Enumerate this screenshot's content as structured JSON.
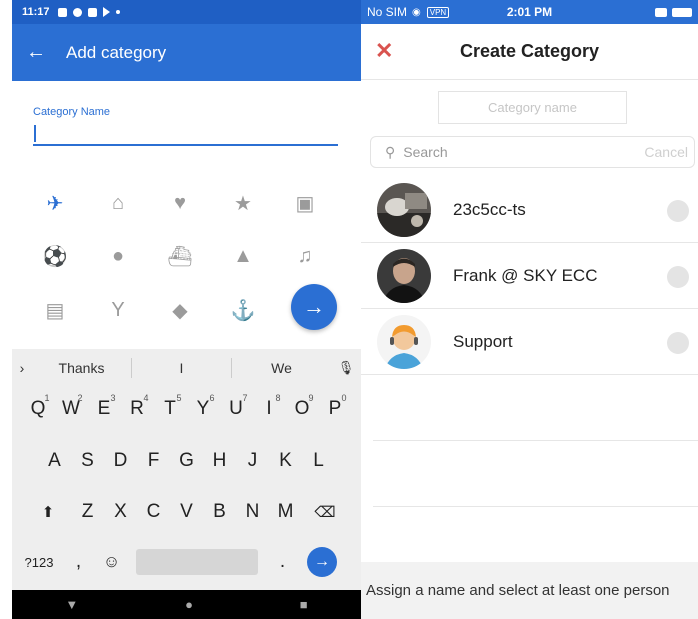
{
  "android": {
    "status": {
      "time": "11:17"
    },
    "appbar": {
      "title": "Add category"
    },
    "form": {
      "label": "Category Name",
      "value": ""
    },
    "icons": [
      "airplane-icon",
      "home-icon",
      "heart-icon",
      "star-icon",
      "briefcase-icon",
      "soccer-icon",
      "baseball-icon",
      "ship-icon",
      "mountain-icon",
      "music-icon",
      "beer-icon",
      "cocktail-icon",
      "diamond-icon",
      "anchor-icon"
    ],
    "keyboard": {
      "suggestions": [
        "Thanks",
        "I",
        "We"
      ],
      "row1": [
        "Q",
        "W",
        "E",
        "R",
        "T",
        "Y",
        "U",
        "I",
        "O",
        "P"
      ],
      "row1_nums": [
        "1",
        "2",
        "3",
        "4",
        "5",
        "6",
        "7",
        "8",
        "9",
        "0"
      ],
      "row2": [
        "A",
        "S",
        "D",
        "F",
        "G",
        "H",
        "J",
        "K",
        "L"
      ],
      "row3": [
        "Z",
        "X",
        "C",
        "V",
        "B",
        "N",
        "M"
      ],
      "sym": "?123",
      "comma": ",",
      "period": "."
    }
  },
  "ios": {
    "status": {
      "carrier": "No SIM",
      "vpn": "VPN",
      "time": "2:01 PM"
    },
    "nav": {
      "title": "Create Category"
    },
    "category_placeholder": "Category name",
    "search": {
      "placeholder": "Search",
      "cancel": "Cancel"
    },
    "contacts": [
      {
        "name": "23c5cc-ts"
      },
      {
        "name": "Frank @ SKY ECC"
      },
      {
        "name": "Support"
      }
    ],
    "footer": "Assign a name and select at least one person"
  }
}
